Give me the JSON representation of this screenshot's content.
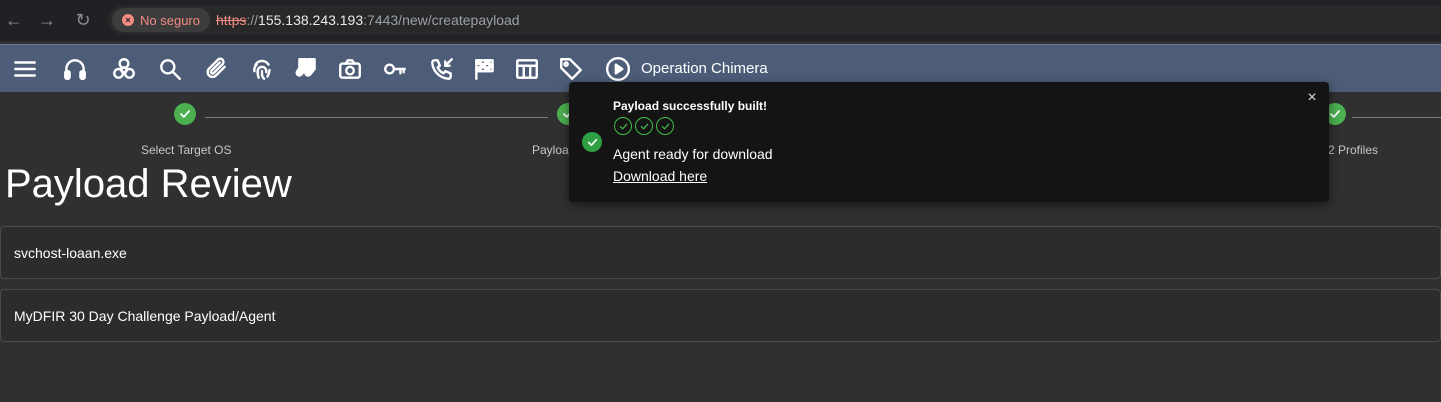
{
  "browser": {
    "security_chip": "No seguro",
    "url_scheme": "https",
    "url_sep": "://",
    "url_host": "155.138.243.193",
    "url_rest": ":7443/new/createpayload"
  },
  "toolbar": {
    "icons": [
      "menu-icon",
      "headphones-icon",
      "biohazard-icon",
      "search-icon",
      "paperclip-icon",
      "fingerprint-icon",
      "socks-icon",
      "camera-icon",
      "key-icon",
      "phone-callback-icon",
      "checkered-flag-icon",
      "table-icon",
      "tag-icon",
      "play-circle-icon"
    ],
    "operation_name": "Operation Chimera"
  },
  "stepper": {
    "steps": [
      {
        "label": "Select Target OS",
        "status": "complete"
      },
      {
        "label": "Payloa",
        "status": "complete"
      },
      {
        "label": "2 Profiles",
        "status": "complete"
      }
    ]
  },
  "page": {
    "title": "Payload Review",
    "cards": [
      "svchost-loaan.exe",
      "MyDFIR 30 Day Challenge Payload/Agent"
    ]
  },
  "toast": {
    "title": "Payload successfully built!",
    "message": "Agent ready for download",
    "link": "Download here",
    "close": "×",
    "accent": "#2ea043"
  },
  "colors": {
    "toolbar_bg": "#4d5d78",
    "page_bg": "#303030",
    "step_complete": "#4caf50"
  }
}
